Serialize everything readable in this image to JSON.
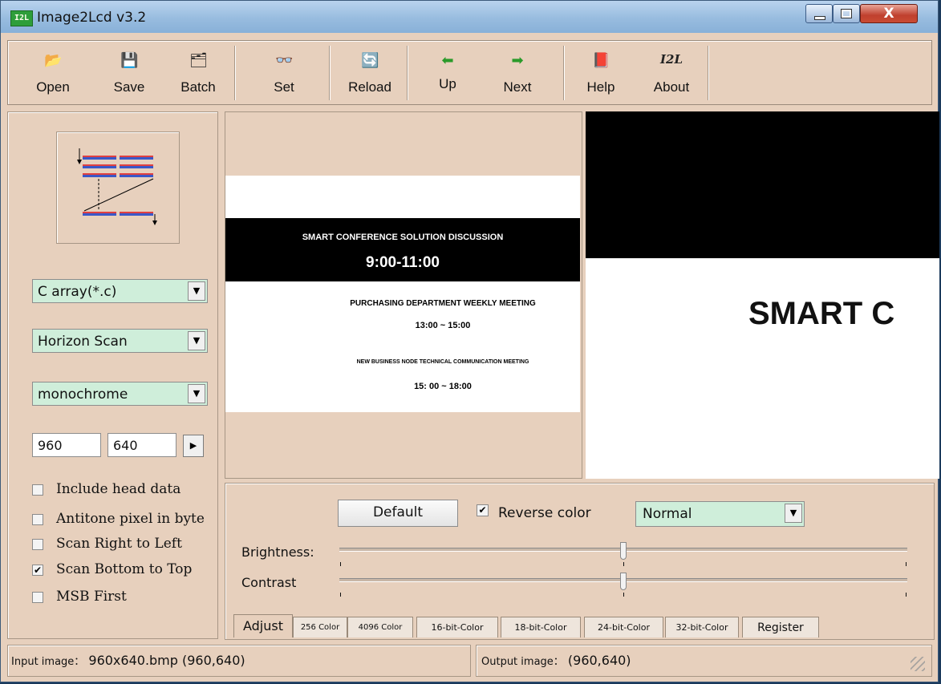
{
  "window": {
    "title": "Image2Lcd v3.2",
    "app_icon_text": "I2L",
    "close_glyph": "X"
  },
  "toolbar": {
    "open": {
      "label": "Open",
      "icon": "📂"
    },
    "save": {
      "label": "Save",
      "icon": "💾"
    },
    "batch": {
      "label": "Batch",
      "icon": "🗂"
    },
    "set": {
      "label": "Set",
      "icon": "👓"
    },
    "reload": {
      "label": "Reload",
      "icon": "🔄"
    },
    "up": {
      "label": "Up",
      "icon": "⬅"
    },
    "next": {
      "label": "Next",
      "icon": "➡"
    },
    "help": {
      "label": "Help",
      "icon": "📕"
    },
    "about": {
      "label": "About",
      "icon": "I2L"
    }
  },
  "left": {
    "output_format": "C array(*.c)",
    "scan_mode": "Horizon Scan",
    "bits_pixel": "monochrome",
    "width": "960",
    "height": "640",
    "dropdown_arrow": "▼",
    "apply_arrow": "▶",
    "options": [
      {
        "label": "Include head data",
        "checked": false
      },
      {
        "label": "Antitone pixel in byte",
        "checked": false
      },
      {
        "label": "Scan Right to Left",
        "checked": false
      },
      {
        "label": "Scan Bottom to Top",
        "checked": true
      },
      {
        "label": "MSB First",
        "checked": false
      }
    ]
  },
  "preview": {
    "line1": "SMART CONFERENCE SOLUTION DISCUSSION",
    "line2": "9:00-11:00",
    "line3": "PURCHASING DEPARTMENT WEEKLY MEETING",
    "line4": "13:00 ~ 15:00",
    "line5": "NEW BUSINESS NODE TECHNICAL COMMUNICATION MEETING",
    "line6": "15: 00 ~ 18:00",
    "output_text": "SMART C"
  },
  "adjust": {
    "default_label": "Default",
    "reverse_label": "Reverse color",
    "reverse_checked": true,
    "mode": "Normal",
    "brightness_label": "Brightness:",
    "contrast_label": "Contrast",
    "brightness_value": 0.5,
    "contrast_value": 0.5
  },
  "tabs": [
    "Adjust",
    "256 Color",
    "4096 Color",
    "16-bit-Color",
    "18-bit-Color",
    "24-bit-Color",
    "32-bit-Color",
    "Register"
  ],
  "status": {
    "input_prefix": "Input image：",
    "input_value": "960x640.bmp (960,640)",
    "output_prefix": "Output image：",
    "output_value": "(960,640)"
  }
}
